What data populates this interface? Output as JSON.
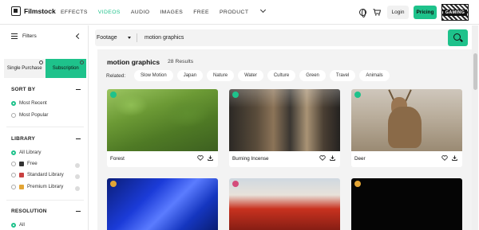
{
  "brand": {
    "name": "Filmstock"
  },
  "nav": {
    "items": [
      "EFFECTS",
      "VIDEOS",
      "AUDIO",
      "IMAGES",
      "FREE",
      "PRODUCT"
    ],
    "active": "VIDEOS"
  },
  "header": {
    "login_label": "Login",
    "pricing_label": "Pricing",
    "avatar_text": "GAMING"
  },
  "sidebar": {
    "filters_label": "Filters",
    "tabs": {
      "single": "Single Purchase",
      "subscription": "Subscription"
    },
    "sort": {
      "title": "SORT BY",
      "options": [
        {
          "label": "Most Recent",
          "selected": true
        },
        {
          "label": "Most Popular",
          "selected": false
        }
      ]
    },
    "library": {
      "title": "LIBRARY",
      "options": [
        {
          "label": "All Library",
          "selected": true
        },
        {
          "label": "Free",
          "selected": false
        },
        {
          "label": "Standard Library",
          "selected": false
        },
        {
          "label": "Premium Library",
          "selected": false
        }
      ]
    },
    "resolution": {
      "title": "RESOLUTION",
      "options": [
        {
          "label": "All",
          "selected": true
        }
      ]
    }
  },
  "search": {
    "type_label": "Footage",
    "query": "motion graphics"
  },
  "results": {
    "title": "motion graphics",
    "count": "28 Results",
    "related_label": "Related:",
    "related": [
      "Slow Motion",
      "Japan",
      "Nature",
      "Water",
      "Culture",
      "Green",
      "Travel",
      "Animals"
    ]
  },
  "cards": [
    {
      "label": "Forest",
      "badge_color": "#1ec28b"
    },
    {
      "label": "Burning Incense",
      "badge_color": "#1ec28b"
    },
    {
      "label": "Deer",
      "badge_color": "#1ec28b"
    },
    {
      "label": "",
      "badge_color": "#e3a535"
    },
    {
      "label": "",
      "badge_color": "#d44b7a"
    },
    {
      "label": "",
      "badge_color": "#e3a535"
    }
  ],
  "colors": {
    "accent": "#1ec28b"
  }
}
